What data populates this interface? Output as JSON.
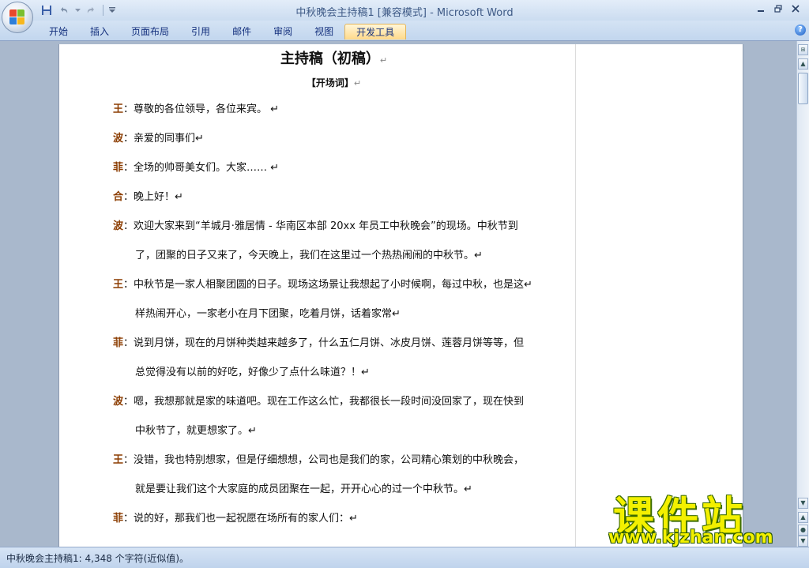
{
  "window": {
    "title": "中秋晚会主持稿1 [兼容模式] - Microsoft Word"
  },
  "quick_access": {
    "save_icon": "save-icon",
    "undo_icon": "undo-icon",
    "redo_icon": "redo-icon"
  },
  "ribbon": {
    "tabs": [
      {
        "label": "开始"
      },
      {
        "label": "插入"
      },
      {
        "label": "页面布局"
      },
      {
        "label": "引用"
      },
      {
        "label": "邮件"
      },
      {
        "label": "审阅"
      },
      {
        "label": "视图"
      },
      {
        "label": "开发工具",
        "active": true
      }
    ],
    "help_label": "?"
  },
  "document": {
    "title": "主持稿（初稿）",
    "section": "【开场词】",
    "paragraph_mark": "↵",
    "paragraphs": [
      {
        "speaker": "王",
        "lines": [
          "：尊敬的各位领导，各位来宾。 ↵"
        ]
      },
      {
        "speaker": "波",
        "lines": [
          "：亲爱的同事们↵"
        ]
      },
      {
        "speaker": "菲",
        "lines": [
          "：全场的帅哥美女们。大家…… ↵"
        ]
      },
      {
        "speaker": "合",
        "lines": [
          "：晚上好！↵"
        ]
      },
      {
        "speaker": "波",
        "lines": [
          "：欢迎大家来到“羊城月·雅居情 - 华南区本部 20xx 年员工中秋晚会”的现场。中秋节到",
          "了，团聚的日子又来了，今天晚上，我们在这里过一个热热闹闹的中秋节。↵"
        ]
      },
      {
        "speaker": "王",
        "lines": [
          "：中秋节是一家人相聚团圆的日子。现场这场景让我想起了小时候啊，每过中秋，也是这↵",
          "样热闹开心，一家老小在月下团聚，吃着月饼，话着家常↵"
        ]
      },
      {
        "speaker": "菲",
        "lines": [
          "：说到月饼，现在的月饼种类越来越多了，什么五仁月饼、冰皮月饼、莲蓉月饼等等，但",
          "总觉得没有以前的好吃，好像少了点什么味道？！↵"
        ]
      },
      {
        "speaker": "波",
        "lines": [
          "：嗯，我想那就是家的味道吧。现在工作这么忙，我都很长一段时间没回家了，现在快到",
          "中秋节了，就更想家了。↵"
        ]
      },
      {
        "speaker": "王",
        "lines": [
          "：没错，我也特别想家，但是仔细想想，公司也是我们的家，公司精心策划的中秋晚会，",
          "就是要让我们这个大家庭的成员团聚在一起，开开心心的过一个中秋节。↵"
        ]
      },
      {
        "speaker": "菲",
        "lines": [
          "：说的好，那我们也一起祝愿在场所有的家人们：↵"
        ]
      }
    ]
  },
  "status_bar": {
    "text": "中秋晚会主持稿1: 4,348 个字符(近似值)。"
  },
  "watermark": {
    "big": "课件站",
    "url": "www.kjzhan.com"
  }
}
